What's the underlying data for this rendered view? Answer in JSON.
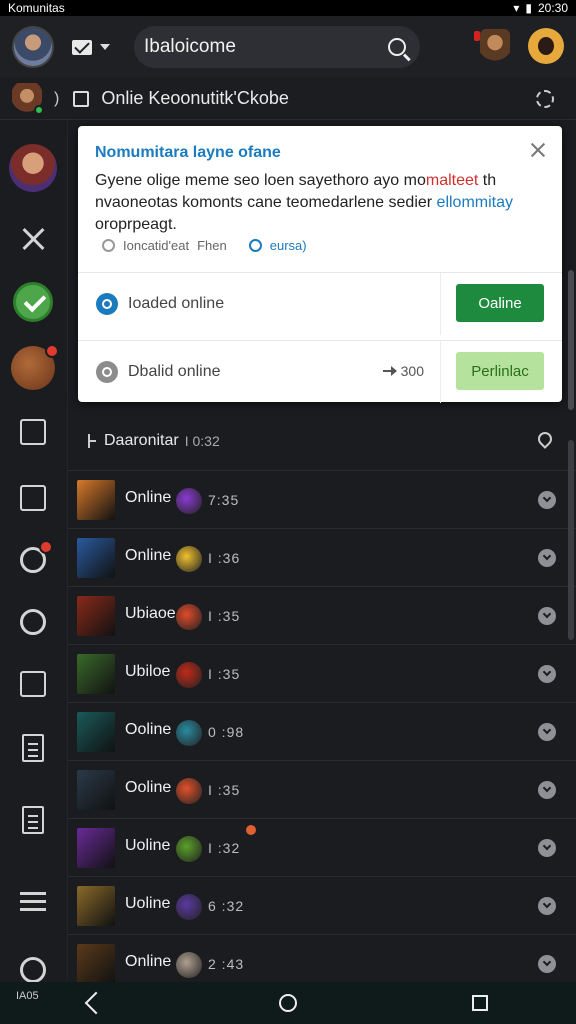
{
  "status_bar": {
    "app_name": "Komunitas",
    "time": "20:30"
  },
  "app_bar": {
    "search_value": "Ibaloicome"
  },
  "sub_header": {
    "title": "Onlie Keoonutitk'Ckobe"
  },
  "notification": {
    "title": "Nomumitara layne ofane",
    "body_part1": "Gyene olige meme seo loen sayethoro ayo mo",
    "body_red": "malteet",
    "body_part2": " th nvaoneotas komonts cane teomedarlene sedier ",
    "body_blue": "ellommitay",
    "body_part3": " oroprpeagt.",
    "meta_left": "Ioncatid'eat",
    "meta_mid": "Fhen",
    "meta_right": "eursa)",
    "row1_status": "Ioaded online",
    "row1_button": "Oaline",
    "row2_status": "Dbalid online",
    "row2_count": "300",
    "row2_button": "Perlinlac"
  },
  "section": {
    "title": "Daaronitar",
    "time": "I 0:32"
  },
  "list": [
    {
      "label": "Online",
      "time": "7:35",
      "thumb": "#d87a2a",
      "icon": "#8a3ad0"
    },
    {
      "label": "Online",
      "time": "I :36",
      "thumb": "#2a5aa0",
      "icon": "#f0c030"
    },
    {
      "label": "Ubiaoe",
      "time": "I :35",
      "thumb": "#8a2a1a",
      "icon": "#e04a2a"
    },
    {
      "label": "Ubiloe",
      "time": "I :35",
      "thumb": "#3a6a2a",
      "icon": "#c02a1a"
    },
    {
      "label": "Ooline",
      "time": "0 :98",
      "thumb": "#1a5a5a",
      "icon": "#2a8aa0"
    },
    {
      "label": "Ooline",
      "time": "I :35",
      "thumb": "#2a3a4a",
      "icon": "#e0502a"
    },
    {
      "label": "Uoline",
      "time": "I :32",
      "thumb": "#6a2a9a",
      "icon": "#5aa02a"
    },
    {
      "label": "Uoline",
      "time": "6 :32",
      "thumb": "#8a6a2a",
      "icon": "#5a3aa0"
    },
    {
      "label": "Online",
      "time": "2 :43",
      "thumb": "#5a3a1a",
      "icon": "#b0a090"
    }
  ],
  "nav": {
    "home_label": "IA05"
  }
}
